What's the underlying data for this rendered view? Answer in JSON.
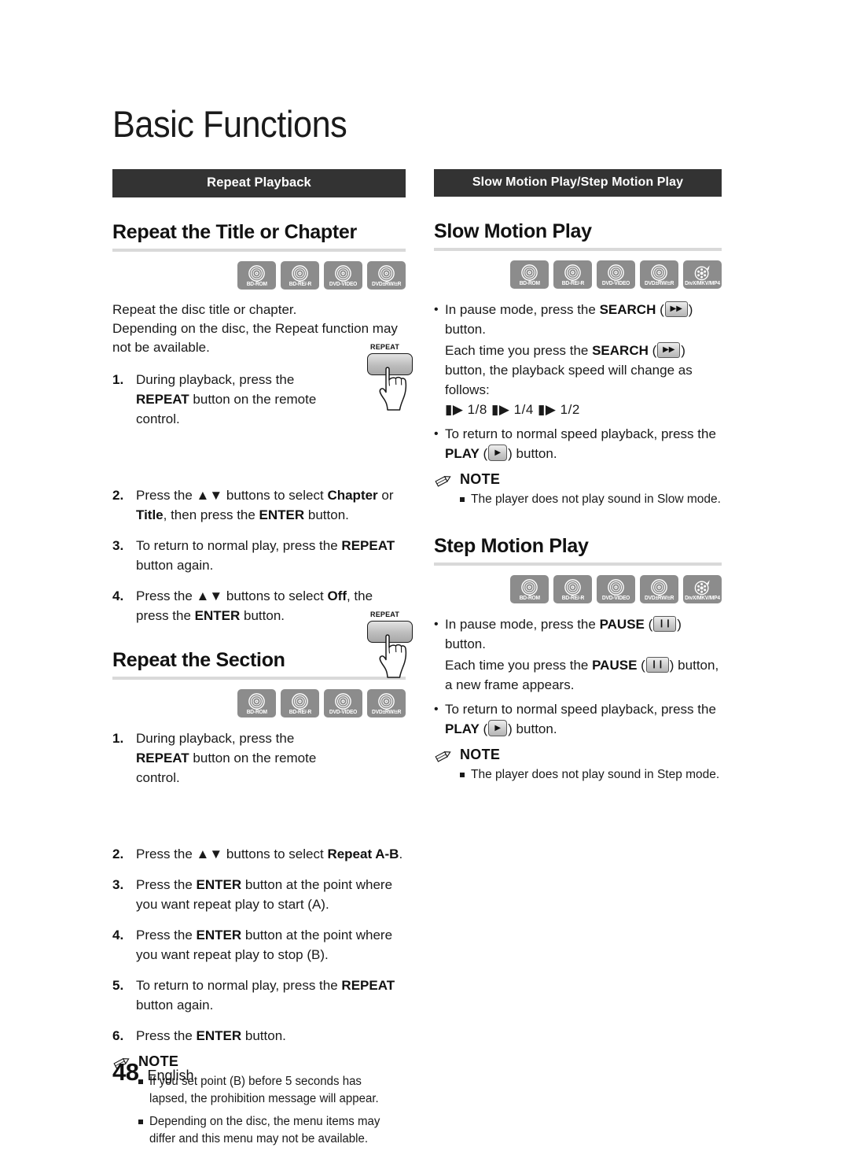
{
  "page": {
    "title": "Basic Functions",
    "footer_number": "48",
    "footer_language": "English"
  },
  "colors": {
    "banner_background": "#333333",
    "banner_text": "#ffffff",
    "rule": "#d9d9d9",
    "badge_background": "#8c8c8c",
    "body_text": "#1a1a1a"
  },
  "left_column": {
    "banner": "Repeat Playback",
    "sections": [
      {
        "heading": "Repeat the Title or Chapter",
        "badges": [
          {
            "icon": "disc-icon",
            "label": "BD-ROM"
          },
          {
            "icon": "disc-icon",
            "label": "BD-RE/-R"
          },
          {
            "icon": "disc-icon",
            "label": "DVD-VIDEO"
          },
          {
            "icon": "disc-icon",
            "label": "DVD±RW/±R"
          }
        ],
        "intro": [
          "Repeat the disc title or chapter.",
          "Depending on the disc, the Repeat function may not be available."
        ],
        "steps": [
          {
            "num": "1.",
            "parts": [
              {
                "t": "During playback, press the ",
                "b": false
              },
              {
                "t": "REPEAT",
                "b": true
              },
              {
                "t": " button on the remote control.",
                "b": false
              }
            ]
          },
          {
            "num": "2.",
            "parts": [
              {
                "t": "Press the ▲▼ buttons to select ",
                "b": false
              },
              {
                "t": "Chapter",
                "b": true
              },
              {
                "t": " or ",
                "b": false
              },
              {
                "t": "Title",
                "b": true
              },
              {
                "t": ", then press the ",
                "b": false
              },
              {
                "t": "ENTER",
                "b": true
              },
              {
                "t": " button.",
                "b": false
              }
            ]
          },
          {
            "num": "3.",
            "parts": [
              {
                "t": "To return to normal play, press the ",
                "b": false
              },
              {
                "t": "REPEAT",
                "b": true
              },
              {
                "t": " button again.",
                "b": false
              }
            ]
          },
          {
            "num": "4.",
            "parts": [
              {
                "t": "Press the ▲▼ buttons to select ",
                "b": false
              },
              {
                "t": "Off",
                "b": true
              },
              {
                "t": ", the press the ",
                "b": false
              },
              {
                "t": "ENTER",
                "b": true
              },
              {
                "t": " button.",
                "b": false
              }
            ]
          }
        ],
        "remote_button_label": "REPEAT"
      },
      {
        "heading": "Repeat the Section",
        "badges": [
          {
            "icon": "disc-icon",
            "label": "BD-ROM"
          },
          {
            "icon": "disc-icon",
            "label": "BD-RE/-R"
          },
          {
            "icon": "disc-icon",
            "label": "DVD-VIDEO"
          },
          {
            "icon": "disc-icon",
            "label": "DVD±RW/±R"
          }
        ],
        "steps": [
          {
            "num": "1.",
            "parts": [
              {
                "t": "During playback, press the ",
                "b": false
              },
              {
                "t": "REPEAT",
                "b": true
              },
              {
                "t": " button on the remote control.",
                "b": false
              }
            ]
          },
          {
            "num": "2.",
            "parts": [
              {
                "t": "Press the ▲▼ buttons to select ",
                "b": false
              },
              {
                "t": "Repeat A-B",
                "b": true
              },
              {
                "t": ".",
                "b": false
              }
            ]
          },
          {
            "num": "3.",
            "parts": [
              {
                "t": "Press the ",
                "b": false
              },
              {
                "t": "ENTER",
                "b": true
              },
              {
                "t": " button at the point where you want repeat play to start (A).",
                "b": false
              }
            ]
          },
          {
            "num": "4.",
            "parts": [
              {
                "t": "Press the ",
                "b": false
              },
              {
                "t": "ENTER",
                "b": true
              },
              {
                "t": " button at the point where you want repeat play to stop (B).",
                "b": false
              }
            ]
          },
          {
            "num": "5.",
            "parts": [
              {
                "t": "To return to normal play, press the ",
                "b": false
              },
              {
                "t": "REPEAT",
                "b": true
              },
              {
                "t": " button again.",
                "b": false
              }
            ]
          },
          {
            "num": "6.",
            "parts": [
              {
                "t": "Press the ",
                "b": false
              },
              {
                "t": "ENTER",
                "b": true
              },
              {
                "t": " button.",
                "b": false
              }
            ]
          }
        ],
        "remote_button_label": "REPEAT",
        "note": {
          "icon": "pencil-icon",
          "title": "NOTE",
          "items": [
            "If you set point (B) before 5 seconds has lapsed, the prohibition message will appear.",
            "Depending on the disc, the menu items may differ and this menu may not be available."
          ]
        }
      }
    ]
  },
  "right_column": {
    "banner": "Slow Motion Play/Step Motion Play",
    "sections": [
      {
        "heading": "Slow Motion Play",
        "badges": [
          {
            "icon": "disc-icon",
            "label": "BD-ROM"
          },
          {
            "icon": "disc-icon",
            "label": "BD-RE/-R"
          },
          {
            "icon": "disc-icon",
            "label": "DVD-VIDEO"
          },
          {
            "icon": "disc-icon",
            "label": "DVD±RW/±R"
          },
          {
            "icon": "film-reel-icon",
            "label": "DivX/MKV/MP4"
          }
        ],
        "bullets": [
          {
            "parts": [
              {
                "t": "In pause mode, press the ",
                "b": false
              },
              {
                "t": "SEARCH",
                "b": true
              },
              {
                "t": " (",
                "b": false
              },
              {
                "key": "search-key",
                "glyph": "▶▶"
              },
              {
                "t": ") button.",
                "b": false
              }
            ],
            "continuation": {
              "parts": [
                {
                  "t": "Each time you press the ",
                  "b": false
                },
                {
                  "t": "SEARCH",
                  "b": true
                },
                {
                  "t": " (",
                  "b": false
                },
                {
                  "key": "search-key",
                  "glyph": "▶▶"
                },
                {
                  "t": ") button, the playback speed will change as follows:",
                  "b": false
                }
              ]
            },
            "speeds": "▮▶ 1/8 ▮▶ 1/4 ▮▶ 1/2"
          },
          {
            "parts": [
              {
                "t": "To return to normal speed playback, press the ",
                "b": false
              },
              {
                "t": "PLAY",
                "b": true
              },
              {
                "t": " (",
                "b": false
              },
              {
                "key": "play-key",
                "glyph": "▶"
              },
              {
                "t": ") button.",
                "b": false
              }
            ]
          }
        ],
        "note": {
          "icon": "pencil-icon",
          "title": "NOTE",
          "items": [
            "The player does not play sound in Slow mode."
          ]
        }
      },
      {
        "heading": "Step Motion Play",
        "badges": [
          {
            "icon": "disc-icon",
            "label": "BD-ROM"
          },
          {
            "icon": "disc-icon",
            "label": "BD-RE/-R"
          },
          {
            "icon": "disc-icon",
            "label": "DVD-VIDEO"
          },
          {
            "icon": "disc-icon",
            "label": "DVD±RW/±R"
          },
          {
            "icon": "film-reel-icon",
            "label": "DivX/MKV/MP4"
          }
        ],
        "bullets": [
          {
            "parts": [
              {
                "t": "In pause mode, press the ",
                "b": false
              },
              {
                "t": "PAUSE",
                "b": true
              },
              {
                "t": " (",
                "b": false
              },
              {
                "key": "pause-key",
                "glyph": "❙❙"
              },
              {
                "t": ") button.",
                "b": false
              }
            ],
            "continuation": {
              "parts": [
                {
                  "t": "Each time you press the ",
                  "b": false
                },
                {
                  "t": "PAUSE",
                  "b": true
                },
                {
                  "t": " (",
                  "b": false
                },
                {
                  "key": "pause-key",
                  "glyph": "❙❙"
                },
                {
                  "t": ") button, a new frame appears.",
                  "b": false
                }
              ]
            }
          },
          {
            "parts": [
              {
                "t": "To return to normal speed playback, press the ",
                "b": false
              },
              {
                "t": "PLAY",
                "b": true
              },
              {
                "t": " (",
                "b": false
              },
              {
                "key": "play-key",
                "glyph": "▶"
              },
              {
                "t": ") button.",
                "b": false
              }
            ]
          }
        ],
        "note": {
          "icon": "pencil-icon",
          "title": "NOTE",
          "items": [
            "The player does not play sound in Step mode."
          ]
        }
      }
    ]
  }
}
